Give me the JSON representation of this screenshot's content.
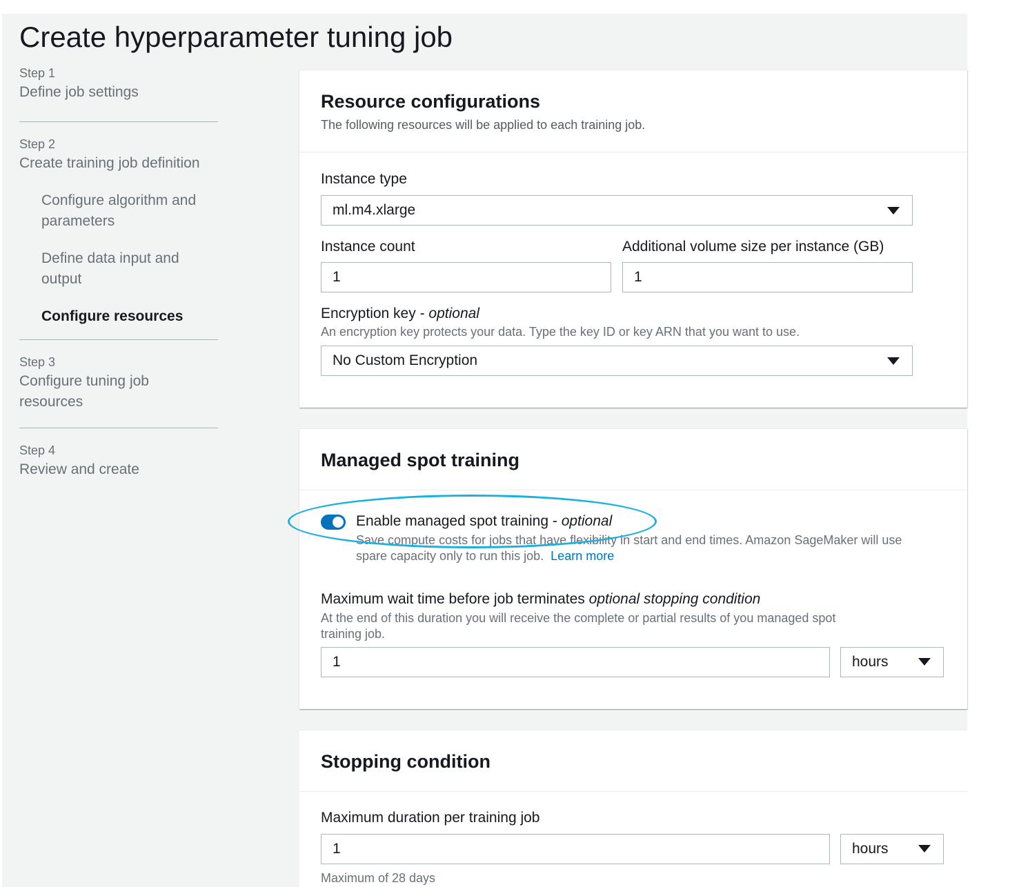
{
  "page": {
    "title": "Create hyperparameter tuning job"
  },
  "sidebar": {
    "step1": {
      "label": "Step 1",
      "title": "Define job settings"
    },
    "step2": {
      "label": "Step 2",
      "title": "Create training job definition",
      "substeps": [
        "Configure algorithm and parameters",
        "Define data input and output",
        "Configure resources"
      ]
    },
    "step3": {
      "label": "Step 3",
      "title": "Configure tuning job resources"
    },
    "step4": {
      "label": "Step 4",
      "title": "Review and create"
    }
  },
  "resource_config": {
    "title": "Resource configurations",
    "description": "The following resources will be applied to each training job.",
    "instance_type_label": "Instance type",
    "instance_type_value": "ml.m4.xlarge",
    "instance_count_label": "Instance count",
    "instance_count_value": "1",
    "volume_label": "Additional volume size per instance (GB)",
    "volume_value": "1",
    "encryption_label": "Encryption key - ",
    "encryption_optional": "optional",
    "encryption_desc": "An encryption key protects your data. Type the key ID or key ARN that you want to use.",
    "encryption_value": "No Custom Encryption"
  },
  "spot_training": {
    "title": "Managed spot training",
    "toggle_label": "Enable managed spot training - ",
    "toggle_optional": "optional",
    "toggle_enabled": true,
    "toggle_desc": "Save compute costs for jobs that have flexibility in start and end times. Amazon SageMaker will use spare capacity only to run this job.",
    "learn_more": "Learn more",
    "max_wait_label": "Maximum wait time before job terminates ",
    "max_wait_optional": "optional stopping condition",
    "max_wait_desc": "At the end of this duration you will receive the complete or partial results of you managed spot training job.",
    "max_wait_value": "1",
    "max_wait_unit": "hours"
  },
  "stopping_condition": {
    "title": "Stopping condition",
    "max_duration_label": "Maximum duration per training job",
    "max_duration_value": "1",
    "max_duration_unit": "hours",
    "max_duration_hint": "Maximum of 28 days"
  },
  "colors": {
    "accent": "#0073bb",
    "highlight": "#1ab0e0",
    "background": "#f2f3f3"
  }
}
